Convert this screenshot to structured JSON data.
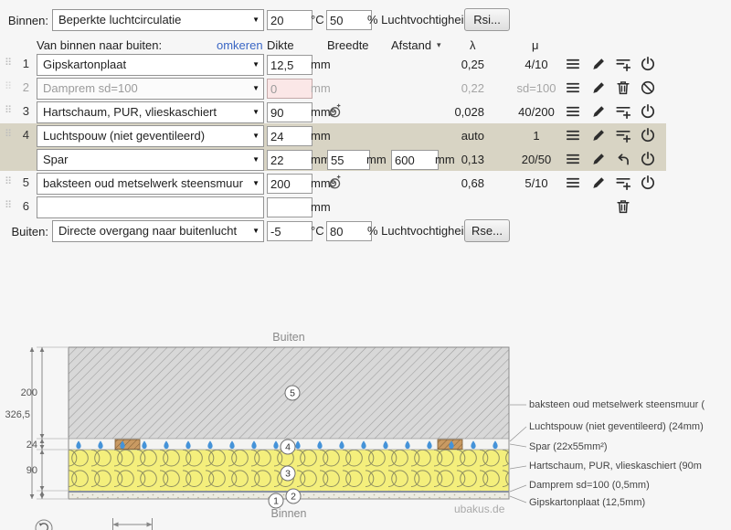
{
  "colors": {
    "highlight_row": "#d8d4c4",
    "link": "#3a66c4",
    "insulation_yellow": "#f4ef7c",
    "brick_gray": "#d8d8d8",
    "droplet_blue": "#4593d8",
    "spar_brown": "#c99a62",
    "invalid_input_bg": "#fbe7e7"
  },
  "icons": {
    "drag_glyph": "⠿",
    "select_arrow": "▼",
    "sort_arrow": "▾"
  },
  "form": {
    "binnen": {
      "label": "Binnen:",
      "material": "Beperkte luchtcirculatie",
      "temp": "20",
      "temp_unit": "°C",
      "humidity": "50",
      "humidity_suffix": "% Luchtvochtigheid",
      "button": "Rsi..."
    },
    "header": {
      "direction": "Van binnen naar buiten:",
      "reverse": "omkeren",
      "thickness": "Dikte",
      "width": "Breedte",
      "distance": "Afstand",
      "lambda": "λ",
      "mu": "μ"
    },
    "rows": [
      {
        "num": "1",
        "material": "Gipskartonplaat",
        "thickness": "12,5",
        "unit": "mm",
        "lambda": "0,25",
        "mu": "4/10"
      },
      {
        "num": "2",
        "material": "Damprem sd=100",
        "thickness": "0",
        "unit": "mm",
        "lambda": "0,22",
        "mu": "sd=100"
      },
      {
        "num": "3",
        "material": "Hartschaum, PUR, vlieskaschiert",
        "thickness": "90",
        "unit": "mm",
        "lambda": "0,028",
        "mu": "40/200"
      },
      {
        "num": "4",
        "material": "Luchtspouw (niet geventileerd)",
        "thickness": "24",
        "unit": "mm",
        "lambda": "auto",
        "mu": "1"
      },
      {
        "num": "",
        "material": "Spar",
        "thickness": "22",
        "unit": "mm",
        "width": "55",
        "width_unit": "mm",
        "distance": "600",
        "distance_unit": "mm",
        "lambda": "0,13",
        "mu": "20/50"
      },
      {
        "num": "5",
        "material": "baksteen oud metselwerk steensmuur",
        "thickness": "200",
        "unit": "mm",
        "lambda": "0,68",
        "mu": "5/10"
      },
      {
        "num": "6",
        "material": "",
        "thickness": "",
        "unit": "mm"
      }
    ],
    "buiten": {
      "label": "Buiten:",
      "material": "Directe overgang naar buitenlucht",
      "temp": "-5",
      "temp_unit": "°C",
      "humidity": "80",
      "humidity_suffix": "% Luchtvochtigheid",
      "button": "Rse..."
    }
  },
  "diagram": {
    "top_label": "Buiten",
    "bottom_label": "Binnen",
    "watermark": "ubakus.de",
    "dims": {
      "total": "326,5",
      "brick": "200",
      "gap": "24",
      "insulation": "90"
    },
    "layer_numbers": [
      "1",
      "2",
      "3",
      "4",
      "5"
    ],
    "labels": [
      "baksteen oud metselwerk steensmuur (",
      "Luchtspouw (niet geventileerd) (24mm)",
      "Spar (22x55mm²)",
      "Hartschaum, PUR, vlieskaschiert (90m",
      "Damprem sd=100 (0,5mm)",
      "Gipskartonplaat (12,5mm)"
    ]
  }
}
